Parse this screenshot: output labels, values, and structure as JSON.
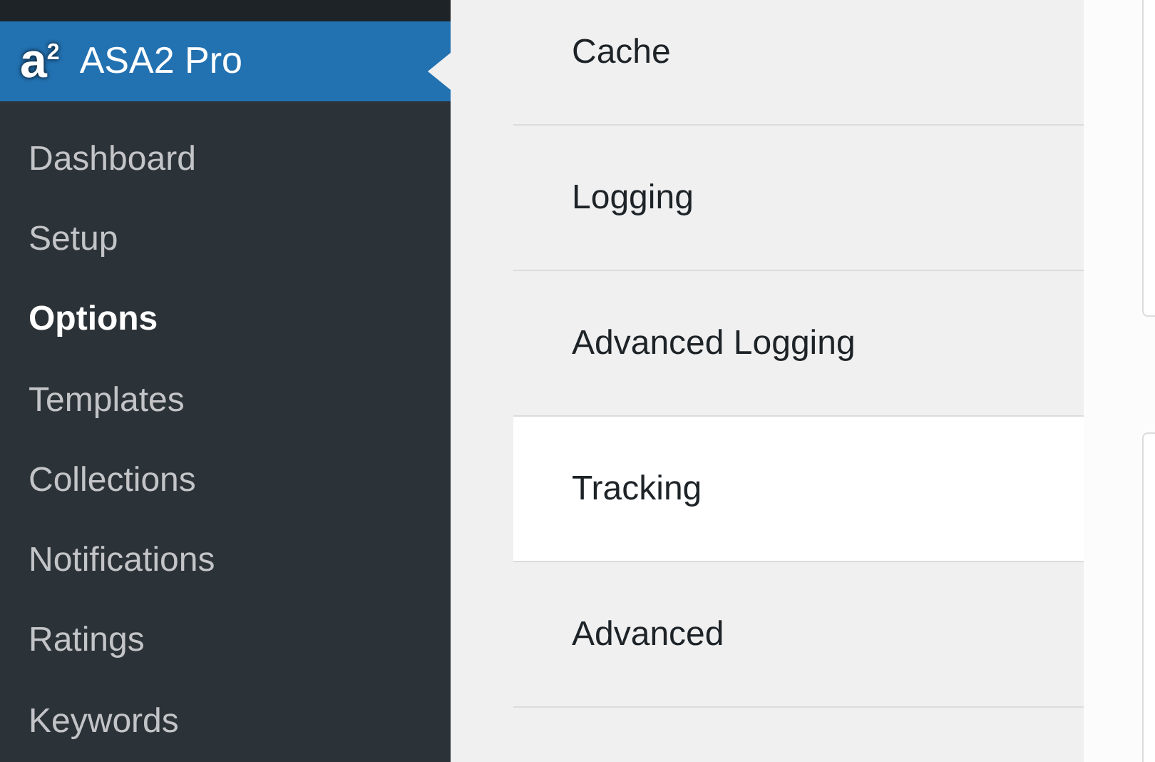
{
  "sidebar": {
    "header": {
      "logo": "a$^{2}$",
      "title": "ASA2 Pro"
    },
    "items": [
      {
        "label": "Dashboard",
        "selected": false
      },
      {
        "label": "Setup",
        "selected": false
      },
      {
        "label": "Options",
        "selected": true
      },
      {
        "label": "Templates",
        "selected": false
      },
      {
        "label": "Collections",
        "selected": false
      },
      {
        "label": "Notifications",
        "selected": false
      },
      {
        "label": "Ratings",
        "selected": false
      },
      {
        "label": "Keywords",
        "selected": false
      }
    ]
  },
  "tabs": [
    {
      "label": "Cache",
      "selected": false
    },
    {
      "label": "Logging",
      "selected": false
    },
    {
      "label": "Advanced Logging",
      "selected": false
    },
    {
      "label": "Tracking",
      "selected": true
    },
    {
      "label": "Advanced",
      "selected": false
    }
  ]
}
